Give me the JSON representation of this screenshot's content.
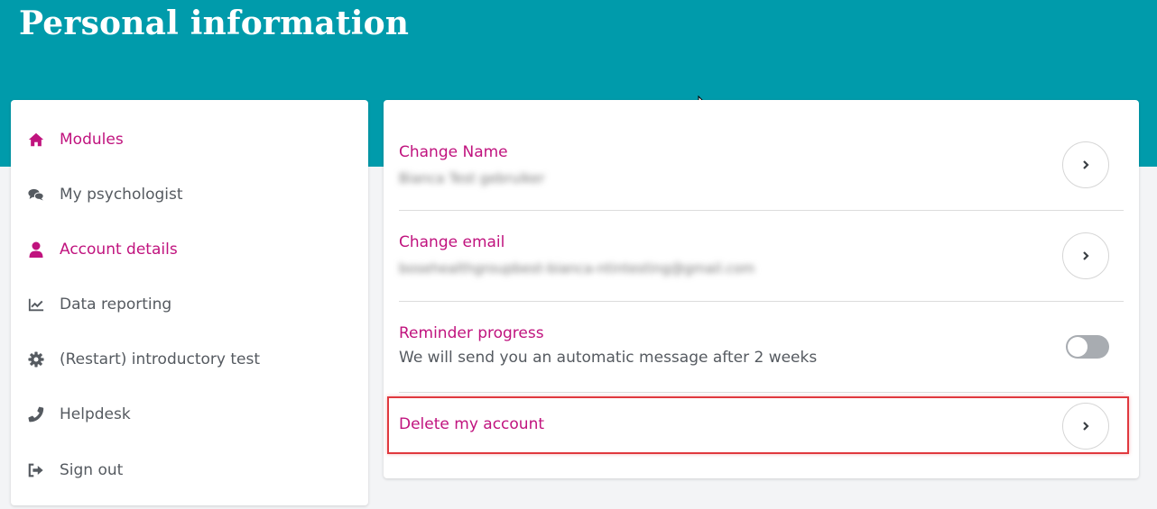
{
  "header": {
    "title": "Personal information"
  },
  "sidebar": {
    "items": [
      {
        "label": "Modules",
        "icon": "home-icon",
        "active": true
      },
      {
        "label": "My psychologist",
        "icon": "chat-bubbles-icon",
        "active": false
      },
      {
        "label": "Account details",
        "icon": "user-icon",
        "active": true
      },
      {
        "label": "Data reporting",
        "icon": "line-chart-icon",
        "active": false
      },
      {
        "label": "(Restart) introductory test",
        "icon": "gear-icon",
        "active": false
      },
      {
        "label": "Helpdesk",
        "icon": "phone-icon",
        "active": false
      },
      {
        "label": "Sign out",
        "icon": "sign-out-icon",
        "active": false
      }
    ]
  },
  "settings": {
    "change_name": {
      "title": "Change Name",
      "value": "Bianca Test gebruiker"
    },
    "change_email": {
      "title": "Change email",
      "value": "bosehealthgroupbest-bianca-ntintesting@gmail.com"
    },
    "reminder": {
      "title": "Reminder progress",
      "description": "We will send you an automatic message after 2 weeks",
      "enabled": false
    },
    "delete_account": {
      "title": "Delete my account"
    }
  },
  "colors": {
    "header_bg": "#009bab",
    "accent": "#c0137e",
    "muted_text": "#555a60",
    "highlight": "#e0393e"
  }
}
